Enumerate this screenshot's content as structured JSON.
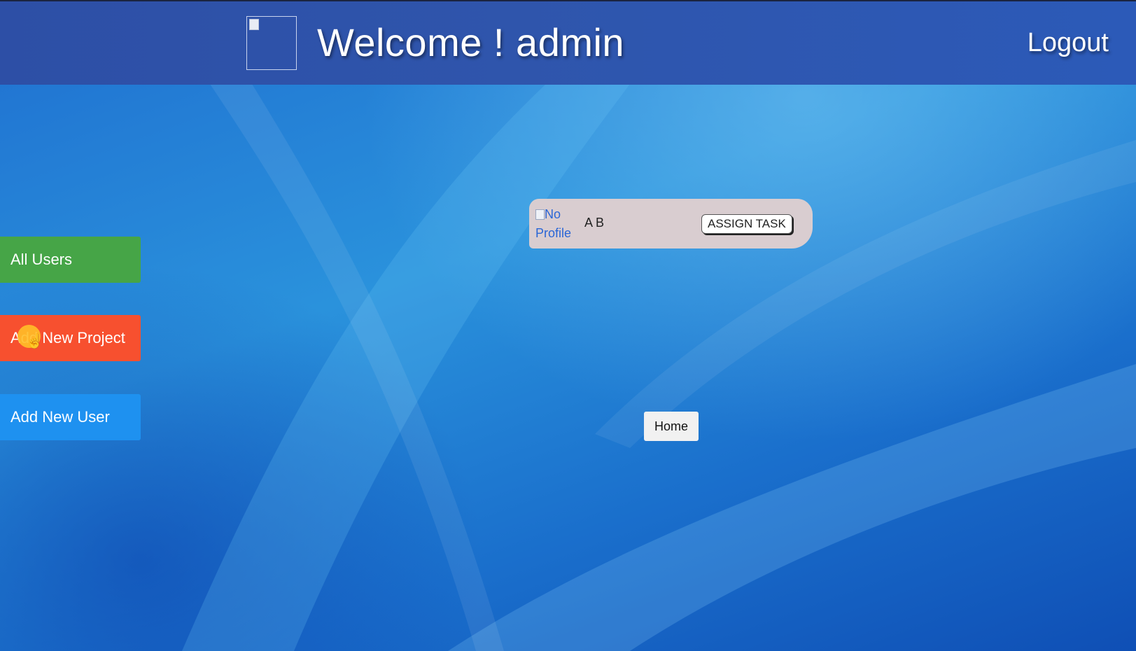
{
  "header": {
    "welcome_text": "Welcome ! admin",
    "logout_label": "Logout",
    "logo_icon": "broken-image-icon"
  },
  "sidebar": {
    "items": [
      {
        "label": "All Users",
        "color": "#46a547"
      },
      {
        "label": "Add New Project",
        "color": "#f7502f"
      },
      {
        "label": "Add New User",
        "color": "#1e91f0"
      }
    ]
  },
  "user_card": {
    "profile_alt": "No Profile",
    "name": "A B",
    "assign_label": "ASSIGN TASK"
  },
  "home_label": "Home",
  "colors": {
    "topbar": "#2f55ac",
    "background": "#2a92dc",
    "card": "#d9cdd0"
  }
}
